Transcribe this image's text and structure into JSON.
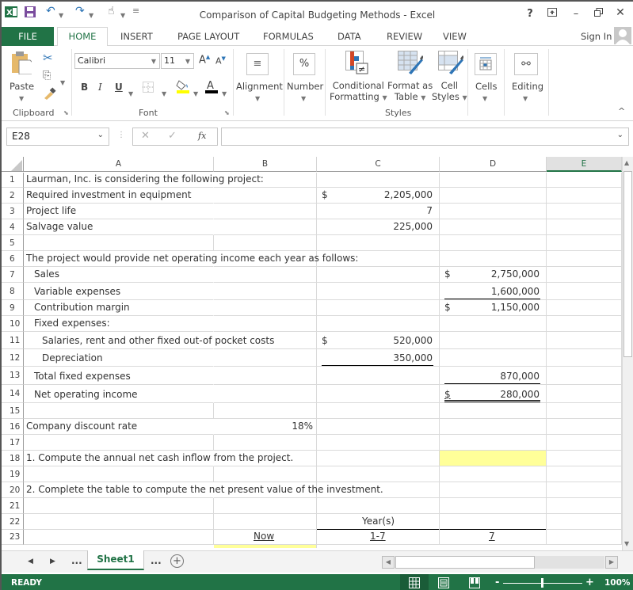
{
  "window": {
    "title": "Comparison of Capital Budgeting Methods - Excel",
    "help": "?",
    "controls": [
      "ribbon-display",
      "minimize",
      "restore",
      "close"
    ]
  },
  "tabs": {
    "file": "FILE",
    "items": [
      "HOME",
      "INSERT",
      "PAGE LAYOUT",
      "FORMULAS",
      "DATA",
      "REVIEW",
      "VIEW"
    ],
    "active": "HOME",
    "sign_in": "Sign In"
  },
  "ribbon": {
    "clipboard": {
      "paste": "Paste",
      "label": "Clipboard"
    },
    "font": {
      "name": "Calibri",
      "size": "11",
      "bold": "B",
      "italic": "I",
      "underline": "U",
      "label": "Font",
      "fill_color": "#ffff00",
      "font_color": "#000000"
    },
    "alignment": {
      "label": "Alignment"
    },
    "number": {
      "label": "Number",
      "glyph": "%"
    },
    "styles": {
      "conditional_1": "Conditional",
      "conditional_2": "Formatting",
      "format_table_1": "Format as",
      "format_table_2": "Table",
      "cell_styles_1": "Cell",
      "cell_styles_2": "Styles",
      "label": "Styles"
    },
    "cells": {
      "label": "Cells"
    },
    "editing": {
      "label": "Editing"
    }
  },
  "formula_bar": {
    "name_box": "E28",
    "cancel": "✕",
    "enter": "✓",
    "fx": "fx",
    "formula": ""
  },
  "grid": {
    "columns": [
      "A",
      "B",
      "C",
      "D",
      "E"
    ],
    "selected_column": "E",
    "rows": [
      {
        "n": "1",
        "a": "Laurman, Inc. is considering the following project:"
      },
      {
        "n": "2",
        "a": "Required investment in equipment",
        "c_cur": "$",
        "c": "2,205,000"
      },
      {
        "n": "3",
        "a": "Project life",
        "c": "7"
      },
      {
        "n": "4",
        "a": "Salvage value",
        "c": "225,000"
      },
      {
        "n": "5"
      },
      {
        "n": "6",
        "a": "The project would provide net operating income each year as follows:"
      },
      {
        "n": "7",
        "a": "Sales",
        "d_cur": "$",
        "d": "2,750,000"
      },
      {
        "n": "8",
        "a": "Variable expenses",
        "d": "1,600,000"
      },
      {
        "n": "9",
        "a": "Contribution margin",
        "d_cur": "$",
        "d": "1,150,000"
      },
      {
        "n": "10",
        "a": "Fixed expenses:"
      },
      {
        "n": "11",
        "a": "Salaries, rent and other fixed out-of pocket costs",
        "c_cur": "$",
        "c": "520,000"
      },
      {
        "n": "12",
        "a": "Depreciation",
        "c": "350,000"
      },
      {
        "n": "13",
        "a": "Total fixed expenses",
        "d": "870,000"
      },
      {
        "n": "14",
        "a": "Net operating income",
        "d_cur": "$",
        "d": "280,000"
      },
      {
        "n": "15"
      },
      {
        "n": "16",
        "a": "Company discount rate",
        "b": "18%"
      },
      {
        "n": "17"
      },
      {
        "n": "18",
        "a": "1. Compute the annual net cash inflow from the project."
      },
      {
        "n": "19"
      },
      {
        "n": "20",
        "a": "2. Complete the table to compute the net present value of the investment."
      },
      {
        "n": "21"
      },
      {
        "n": "22",
        "c": "Year(s)"
      },
      {
        "n": "23",
        "b": "Now",
        "c": "1-7",
        "d": "7"
      }
    ]
  },
  "sheets": {
    "nav_prev": "◀",
    "nav_next": "▶",
    "ellipsis": "...",
    "active": "Sheet1",
    "add": "+"
  },
  "status": {
    "ready": "READY",
    "zoom": "100%",
    "zoom_minus": "-",
    "zoom_plus": "+"
  },
  "colors": {
    "excel_green": "#217346",
    "input_yellow": "#ffff99"
  }
}
